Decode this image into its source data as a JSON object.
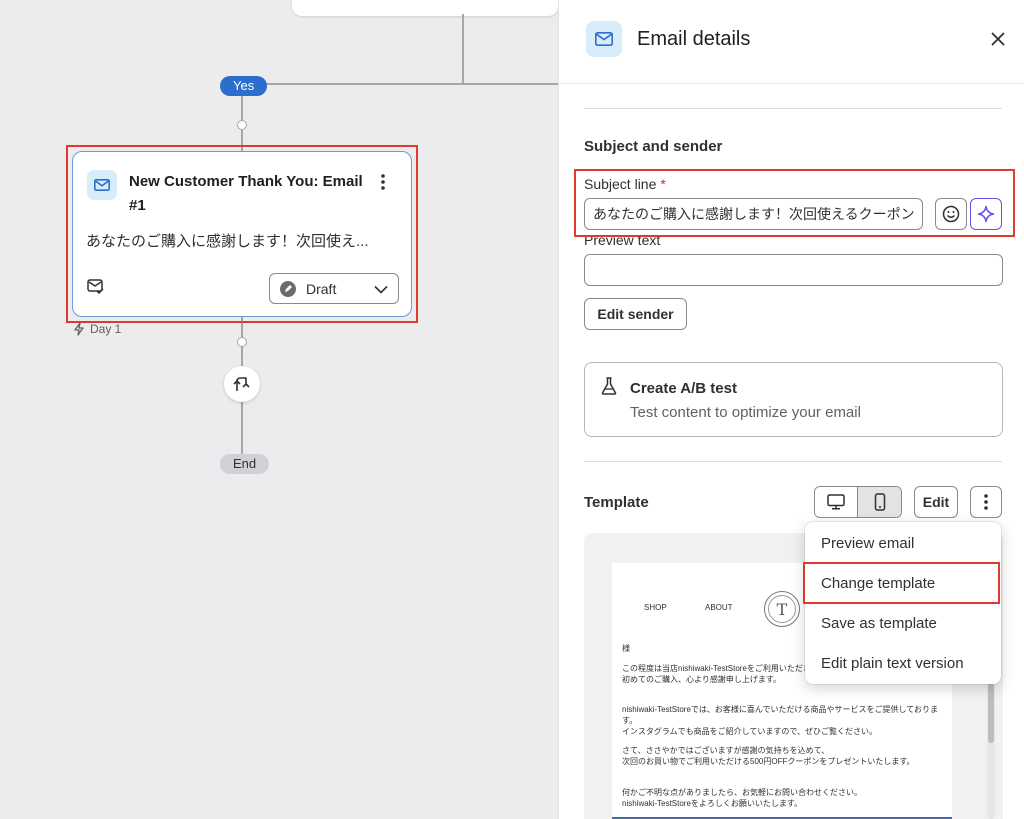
{
  "canvas": {
    "yes_label": "Yes",
    "end_label": "End",
    "day_label": "Day 1",
    "node": {
      "title": "New Customer Thank You: Email #1",
      "preview": "あなたのご購入に感謝します！次回使え...",
      "status": "Draft"
    }
  },
  "panel": {
    "title": "Email details",
    "section_subject": "Subject and sender",
    "subject_label": "Subject line",
    "required_mark": "*",
    "subject_value": "あなたのご購入に感謝します！次回使えるクーポン",
    "preview_text_label": "Preview text",
    "preview_text_value": "",
    "edit_sender": "Edit sender",
    "ab_title": "Create A/B test",
    "ab_subtitle": "Test content to optimize your email",
    "template_heading": "Template",
    "edit_button": "Edit"
  },
  "email_preview": {
    "nav_shop": "SHOP",
    "nav_about": "ABOUT",
    "logo_letter": "T",
    "lines": [
      "様",
      "この程度は当店nishiwaki-TestStoreをご利用いただき",
      "初めてのご購入、心より感謝申し上げます。",
      "nishiwaki-TestStoreでは、お客様に喜んでいただける商品やサービスをご提供しておりま",
      "す。",
      "インスタグラムでも商品をご紹介していますので、ぜひご覧ください。",
      "さて、ささやかではございますが感謝の気持ちを込めて、",
      "次回のお買い物でご利用いただける500円OFFクーポンをプレゼントいたします。",
      "何かご不明な点がありましたら、お気軽にお問い合わせください。",
      "nishiwaki-TestStoreをよろしくお願いいたします。"
    ]
  },
  "menu": {
    "items": [
      "Preview email",
      "Change template",
      "Save as template",
      "Edit plain text version"
    ]
  },
  "colors": {
    "highlight": "#e03a2f",
    "accent_blue": "#2c6ecb",
    "ai_purple": "#6b4ee6",
    "email_footer": "#4769a8"
  },
  "icons": [
    "mail-icon",
    "kebab-icon",
    "mail-check-icon",
    "draft-status-icon",
    "chevron-down-icon",
    "lightning-icon",
    "split-arrows-icon",
    "close-icon",
    "emoji-icon",
    "sparkle-icon",
    "flask-icon",
    "desktop-icon",
    "mobile-icon"
  ]
}
